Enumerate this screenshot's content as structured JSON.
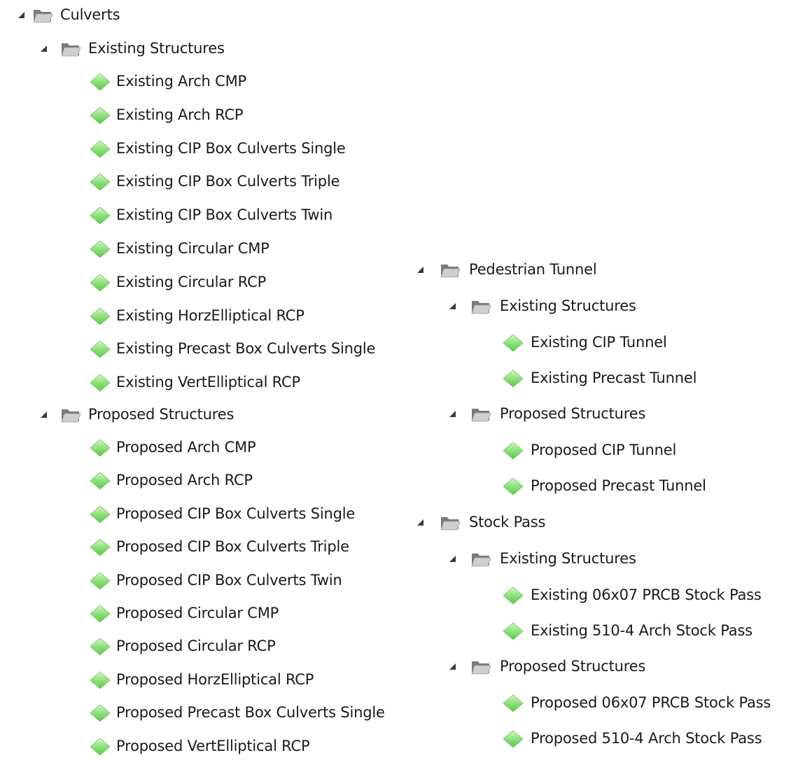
{
  "palette": {
    "folder_back": "#7a7a7a",
    "folder_front": "#cfcfcf",
    "leaf_top": "#d6f7c9",
    "leaf_mid": "#8fe07c",
    "leaf_bottom": "#5cc94a",
    "expander": "#3a3a3a"
  },
  "icons": {
    "expander": "expanded-triangle-icon",
    "folder": "folder-icon",
    "leaf": "green-diamond-icon"
  },
  "tree_left": {
    "root": {
      "label": "Culverts",
      "groups": [
        {
          "label": "Existing Structures",
          "items": [
            "Existing Arch CMP",
            "Existing Arch RCP",
            "Existing CIP Box Culverts Single",
            "Existing CIP Box Culverts Triple",
            "Existing CIP Box Culverts Twin",
            "Existing Circular CMP",
            "Existing Circular RCP",
            "Existing HorzElliptical RCP",
            "Existing Precast Box Culverts Single",
            "Existing VertElliptical RCP"
          ]
        },
        {
          "label": "Proposed Structures",
          "items": [
            "Proposed Arch CMP",
            "Proposed Arch RCP",
            "Proposed CIP Box Culverts Single",
            "Proposed CIP Box Culverts Triple",
            "Proposed CIP Box Culverts Twin",
            "Proposed Circular CMP",
            "Proposed Circular RCP",
            "Proposed HorzElliptical RCP",
            "Proposed Precast Box Culverts Single",
            "Proposed VertElliptical RCP"
          ]
        }
      ]
    }
  },
  "tree_right": {
    "roots": [
      {
        "label": "Pedestrian Tunnel",
        "groups": [
          {
            "label": "Existing Structures",
            "items": [
              "Existing CIP Tunnel",
              "Existing Precast Tunnel"
            ]
          },
          {
            "label": "Proposed Structures",
            "items": [
              "Proposed CIP Tunnel",
              "Proposed Precast Tunnel"
            ]
          }
        ]
      },
      {
        "label": "Stock Pass",
        "groups": [
          {
            "label": "Existing Structures",
            "items": [
              "Existing 06x07 PRCB Stock Pass",
              "Existing 510-4 Arch Stock Pass"
            ]
          },
          {
            "label": "Proposed Structures",
            "items": [
              "Proposed 06x07 PRCB Stock Pass",
              "Proposed 510-4 Arch Stock Pass"
            ]
          }
        ]
      }
    ]
  }
}
